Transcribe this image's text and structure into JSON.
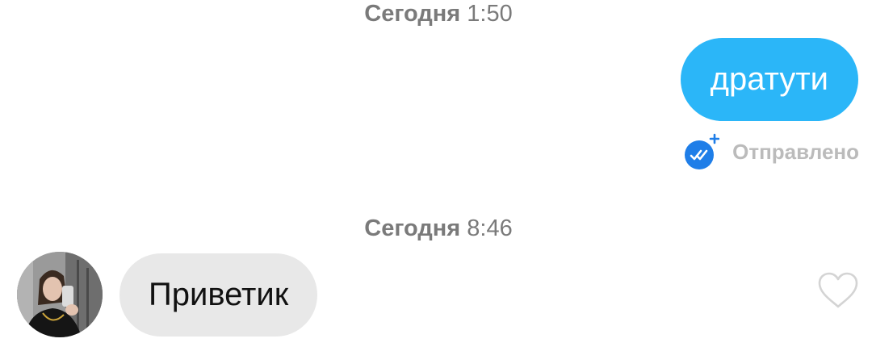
{
  "messages": {
    "group1": {
      "timestamp_day": "Сегодня",
      "timestamp_time": "1:50"
    },
    "outgoing": {
      "text": "дратути",
      "status": "Отправлено",
      "bubble_color": "#2bb6f8",
      "status_icon": "double-check-icon"
    },
    "group2": {
      "timestamp_day": "Сегодня",
      "timestamp_time": "8:46"
    },
    "incoming": {
      "text": "Приветик",
      "bubble_color": "#e8e8e8",
      "like_icon": "heart-outline-icon"
    }
  }
}
